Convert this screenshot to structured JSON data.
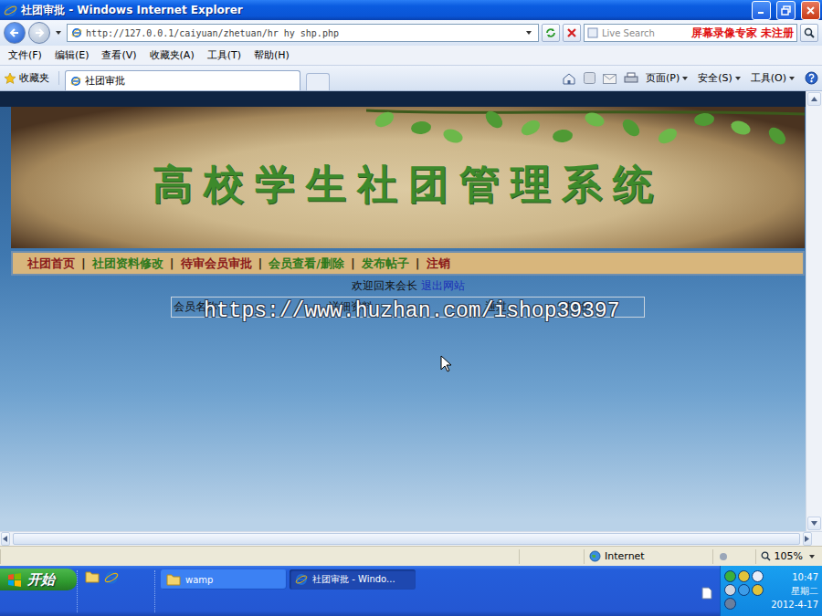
{
  "window": {
    "title": "社团审批 - Windows Internet Explorer"
  },
  "address_bar": {
    "url": "http://127.0.0.1/caiyuan/zhetuan/hr_hy_shp.php",
    "search_placeholder": "Live Search",
    "recorder_mark": "屏幕录像专家 未注册"
  },
  "menu": [
    "文件(F)",
    "编辑(E)",
    "查看(V)",
    "收藏夹(A)",
    "工具(T)",
    "帮助(H)"
  ],
  "favorites": {
    "label": "收藏夹"
  },
  "tabs": [
    {
      "label": "社团审批",
      "selected": true
    }
  ],
  "command_bar": [
    "页面(P)",
    "安全(S)",
    "工具(O)"
  ],
  "page": {
    "site_title": "高校学生社团管理系统",
    "nav_separator": "|",
    "nav": [
      {
        "label": "社团首页",
        "color": "#8b1a1a"
      },
      {
        "label": "社团资料修改",
        "color": "#2f7a1c"
      },
      {
        "label": "待审会员审批",
        "color": "#8b1a1a"
      },
      {
        "label": "会员查看/删除",
        "color": "#2f7a1c"
      },
      {
        "label": "发布帖子",
        "color": "#2f7a1c"
      },
      {
        "label": "注销",
        "color": "#8b1a1a"
      }
    ],
    "welcome": "欢迎回来会长",
    "logout_link": "退出网站",
    "table": {
      "columns": [
        "会员名称",
        "详细资料",
        "通过",
        "拒绝"
      ],
      "rows": []
    },
    "watermark": "https://www.huzhan.com/ishop39397"
  },
  "status_bar": {
    "zone": "Internet",
    "zoom": "105%"
  },
  "taskbar": {
    "start": "开始",
    "tasks": [
      {
        "label": "wamp",
        "selected": false
      },
      {
        "label": "社团审批 - Windo...",
        "selected": true
      }
    ],
    "clock": {
      "time": "10:47",
      "day": "星期二",
      "date": "2012-4-17"
    }
  }
}
